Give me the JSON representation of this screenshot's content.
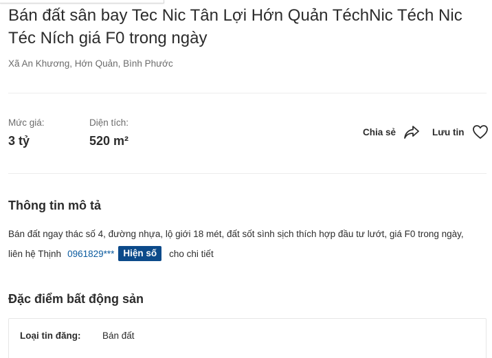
{
  "listing": {
    "title": "Bán đất sân bay Tec Nic Tân Lợi Hớn Quản TéchNic Téch Nic Téc Ních giá F0 trong ngày",
    "address": "Xã An Khương, Hớn Quản, Bình Phước"
  },
  "stats": {
    "price_label": "Mức giá:",
    "price_value": "3 tỷ",
    "area_label": "Diện tích:",
    "area_value": "520 m²"
  },
  "actions": {
    "share_label": "Chia sẻ",
    "share_icon": "share-arrow-icon",
    "save_label": "Lưu tin",
    "save_icon": "heart-icon"
  },
  "description": {
    "heading": "Thông tin mô tả",
    "line1": "Bán đất ngay thác số 4, đường nhựa, lộ giới 18 mét, đất sốt sình sịch thích hợp đầu tư lướt, giá F0 trong ngày,",
    "contact_prefix": "liên hệ Thịnh",
    "phone_masked": "0961829***",
    "reveal_label": "Hiện số",
    "contact_suffix": "cho chi tiết"
  },
  "features": {
    "heading": "Đặc điểm bất động sản",
    "rows": [
      {
        "label": "Loại tin đăng:",
        "value": "Bán đất"
      }
    ]
  },
  "colors": {
    "text": "#2c2c2c",
    "muted": "#6b6b6b",
    "phone_link": "#0a5a9e",
    "button_bg": "#0c4a8a",
    "divider": "#ececec"
  }
}
